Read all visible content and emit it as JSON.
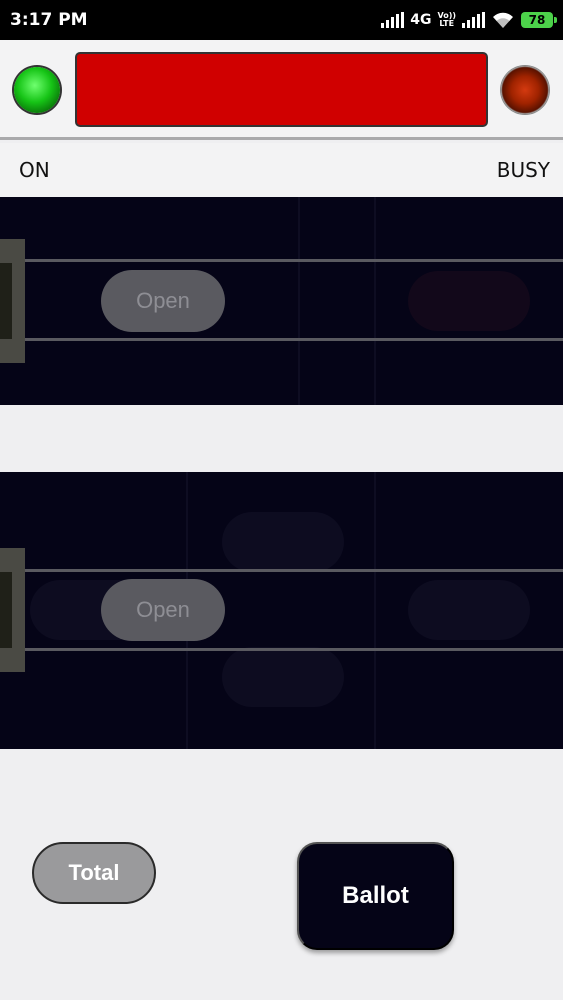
{
  "status_bar": {
    "time": "3:17 PM",
    "network": "4G",
    "volte_line1": "Vo))",
    "volte_line2": "LTE",
    "battery": "78"
  },
  "header": {
    "left_indicator": "green-led-icon",
    "right_indicator": "red-led-icon",
    "display_color": "#d00000"
  },
  "labels": {
    "left": "ON",
    "right": "BUSY"
  },
  "panel_1": {
    "open_label": "Open"
  },
  "panel_2": {
    "open_label": "Open"
  },
  "buttons": {
    "total": "Total",
    "ballot": "Ballot"
  },
  "colors": {
    "panel_bg": "#050417",
    "green_led": "#16c416",
    "red_display": "#d00000"
  }
}
